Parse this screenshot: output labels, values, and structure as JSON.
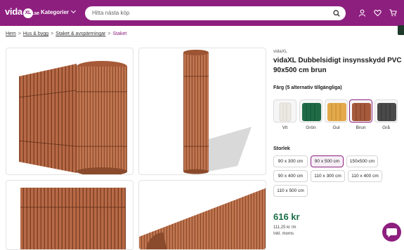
{
  "header": {
    "logo_main": "vida",
    "logo_xl": "XL",
    "logo_tld": ".se",
    "categories_label": "Kategorier",
    "search_placeholder": "Hitta nästa köp",
    "colors": {
      "bar": "#8d1f7f",
      "accent": "#8d1f7f"
    }
  },
  "breadcrumb": {
    "items": [
      "Hem",
      "Hus & bygg",
      "Staket & avspärrningar"
    ],
    "current": "Staket",
    "separator": ">"
  },
  "product": {
    "brand": "vidaXL",
    "title": "vidaXL Dubbelsidigt insynsskydd PVC 90x500 cm brun",
    "color_label": "Färg (5 alternativ tillgängliga)",
    "colors": [
      {
        "name": "Vit",
        "hex": "#ece9e2",
        "selected": false
      },
      {
        "name": "Grön",
        "hex": "#1f6b46",
        "selected": false
      },
      {
        "name": "Gul",
        "hex": "#e3a94a",
        "selected": false
      },
      {
        "name": "Brun",
        "hex": "#a55a3c",
        "selected": true
      },
      {
        "name": "Grå",
        "hex": "#4a4a4a",
        "selected": false
      }
    ],
    "size_label": "Storlek",
    "sizes": [
      {
        "label": "90 x 300 cm",
        "selected": false
      },
      {
        "label": "90 x 500 cm",
        "selected": true
      },
      {
        "label": "150x500 cm",
        "selected": false
      },
      {
        "label": "90 x 400 cm",
        "selected": false
      },
      {
        "label": "110 x 300 cm",
        "selected": false
      },
      {
        "label": "110 x 400 cm",
        "selected": false
      },
      {
        "label": "110 x 500 cm",
        "selected": false
      }
    ],
    "price": "616 kr",
    "unit_price": "111,25 kr /m",
    "vat": "Inkl. moms",
    "price_color": "#1a6f46"
  },
  "icons": [
    "search-icon",
    "user-icon",
    "heart-icon",
    "cart-icon",
    "chat-icon"
  ]
}
